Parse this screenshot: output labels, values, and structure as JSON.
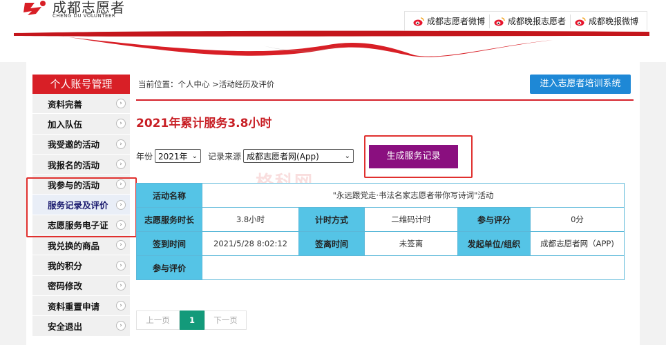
{
  "header": {
    "logo_cn": "成都志愿者",
    "logo_en": "CHENG DU VOLUNTEER",
    "weibo_links": [
      {
        "label": "成都志愿者微博"
      },
      {
        "label": "成都晚报志愿者"
      },
      {
        "label": "成都晚报微博"
      }
    ]
  },
  "sidebar": {
    "title": "个人账号管理",
    "items": [
      {
        "label": "资料完善"
      },
      {
        "label": "加入队伍"
      },
      {
        "label": "我受邀的活动"
      },
      {
        "label": "我报名的活动"
      },
      {
        "label": "我参与的活动"
      },
      {
        "label": "服务记录及评价"
      },
      {
        "label": "志愿服务电子证"
      },
      {
        "label": "我兑换的商品"
      },
      {
        "label": "我的积分"
      },
      {
        "label": "密码修改"
      },
      {
        "label": "资料重置申请"
      },
      {
        "label": "安全退出"
      }
    ]
  },
  "main": {
    "breadcrumb": "当前位置：个人中心 >活动经历及评价",
    "training_button": "进入志愿者培训系统",
    "summary": "2021年累计服务3.8小时",
    "filter": {
      "year_label": "年份",
      "year_value": "2021年",
      "source_label": "记录来源",
      "source_value": "成都志愿者网(App)"
    },
    "generate_button": "生成服务记录",
    "table": {
      "activity_name_label": "活动名称",
      "activity_name": "\"永远跟党走·书法名家志愿者带你写诗词\"活动",
      "duration_label": "志愿服务时长",
      "duration": "3.8小时",
      "timing_label": "计时方式",
      "timing": "二维码计时",
      "rating_label": "参与评分",
      "rating": "0分",
      "signin_label": "签到时间",
      "signin": "2021/5/28 8:02:12",
      "signout_label": "签离时间",
      "signout": "未签离",
      "org_label": "发起单位/组织",
      "org": "成都志愿者网（APP)",
      "review_label": "参与评价",
      "review": ""
    },
    "pagination": {
      "prev": "上一页",
      "current": "1",
      "next": "下一页"
    }
  },
  "watermark": "格科网",
  "colors": {
    "brand_red": "#d81f26",
    "table_header": "#55c4e6",
    "generate_button": "#8a0f7f",
    "training_button": "#1e88d6",
    "pager_active": "#139a7a"
  }
}
